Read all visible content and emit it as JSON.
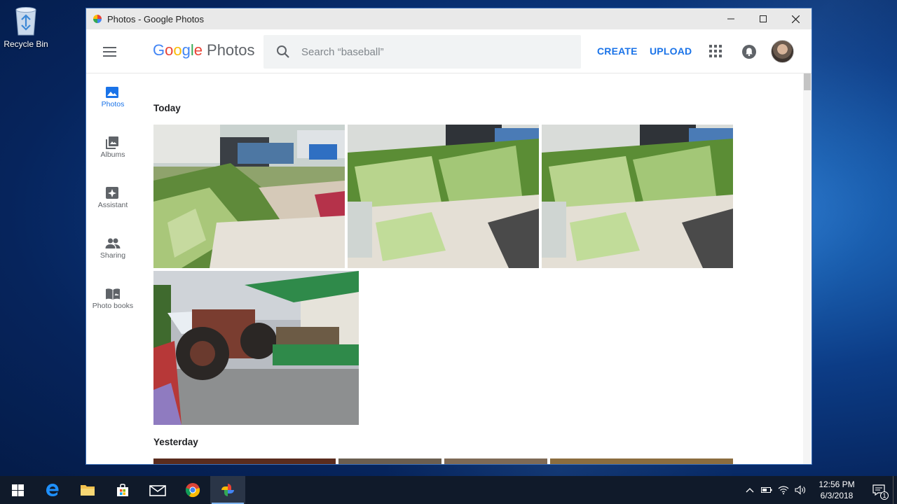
{
  "desktop": {
    "recycle_bin_label": "Recycle Bin"
  },
  "window": {
    "title": "Photos - Google Photos"
  },
  "header": {
    "logo_google": [
      "G",
      "o",
      "o",
      "g",
      "l",
      "e"
    ],
    "logo_product": "Photos",
    "search_placeholder": "Search “baseball”",
    "create_label": "CREATE",
    "upload_label": "UPLOAD"
  },
  "sidebar": {
    "items": [
      {
        "label": "Photos",
        "icon": "photo-icon",
        "active": true
      },
      {
        "label": "Albums",
        "icon": "albums-icon",
        "active": false
      },
      {
        "label": "Assistant",
        "icon": "assistant-icon",
        "active": false
      },
      {
        "label": "Sharing",
        "icon": "people-icon",
        "active": false
      },
      {
        "label": "Photo books",
        "icon": "book-icon",
        "active": false
      }
    ]
  },
  "sections": [
    {
      "title": "Today",
      "photo_count": 4
    },
    {
      "title": "Yesterday"
    }
  ],
  "taskbar": {
    "apps": [
      "windows-start-icon",
      "edge-icon",
      "file-explorer-icon",
      "store-icon",
      "mail-icon",
      "chrome-icon",
      "google-photos-icon"
    ],
    "time": "12:56 PM",
    "date": "6/3/2018",
    "notification_count": "1"
  },
  "colors": {
    "accent": "#1a73e8",
    "taskbar": "#101a2a"
  }
}
